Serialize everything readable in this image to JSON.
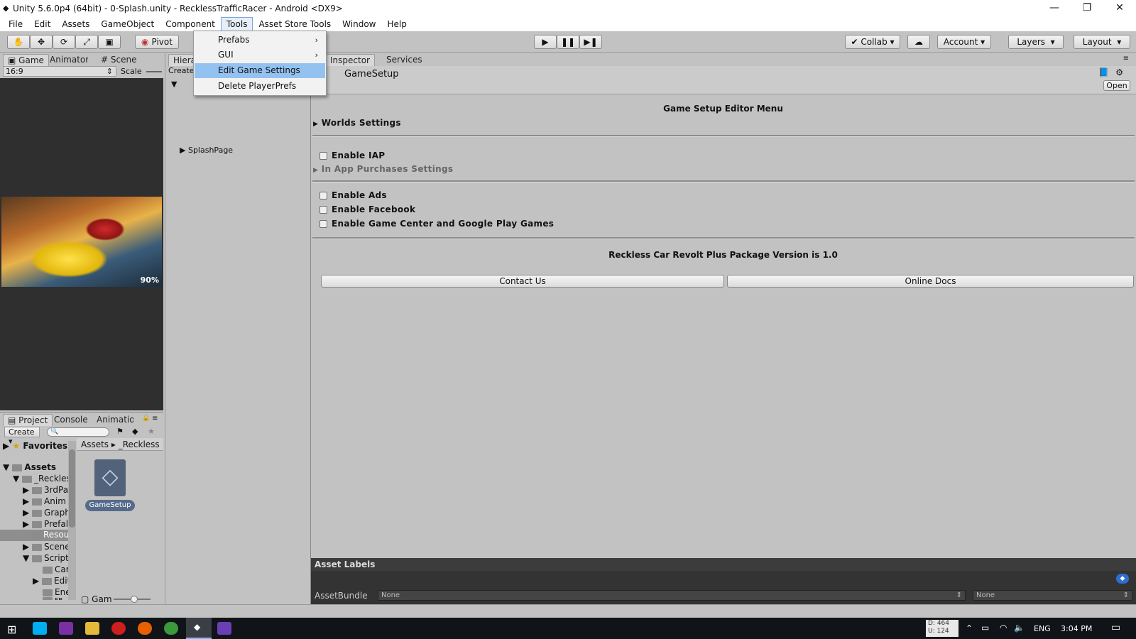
{
  "window": {
    "title": "Unity 5.6.0p4 (64bit) - 0-Splash.unity - RecklessTrafficRacer - Android <DX9>",
    "minimize": "—",
    "restore": "❐",
    "close": "✕"
  },
  "menu": [
    "File",
    "Edit",
    "Assets",
    "GameObject",
    "Component",
    "Tools",
    "Asset Store Tools",
    "Window",
    "Help"
  ],
  "tools_dropdown": {
    "items": [
      {
        "label": "Prefabs",
        "submenu": true
      },
      {
        "label": "GUI",
        "submenu": true
      },
      {
        "label": "Edit Game Settings",
        "highlighted": true
      },
      {
        "label": "Delete PlayerPrefs"
      }
    ]
  },
  "toolbar": {
    "pivot": "Pivot",
    "collab": "Collab",
    "account": "Account",
    "layers": "Layers",
    "layout": "Layout"
  },
  "game_panel": {
    "tabs": [
      "Game",
      "Animator",
      "Scene"
    ],
    "aspect": "16:9",
    "scale": "Scale",
    "zoom_badge": "90%"
  },
  "hierarchy": {
    "tab": "Hierarchy",
    "create": "Create",
    "item": "SplashPage"
  },
  "inspector": {
    "tabs": [
      "Inspector",
      "Services"
    ],
    "object_name": "GameSetup",
    "open_button": "Open",
    "header": "Game Setup Editor Menu",
    "worlds": "Worlds Settings",
    "enable_iap": "Enable IAP",
    "iap_settings": "In App Purchases Settings",
    "enable_ads": "Enable Ads",
    "enable_facebook": "Enable Facebook",
    "enable_gamecenter": "Enable Game Center and Google Play Games",
    "version": "Reckless Car Revolt Plus Package Version is 1.0",
    "contact": "Contact Us",
    "docs": "Online Docs",
    "asset_labels": "Asset Labels",
    "asset_bundle": "AssetBundle",
    "bundle_none_1": "None",
    "bundle_none_2": "None"
  },
  "project": {
    "tabs": [
      "Project",
      "Console",
      "Animation"
    ],
    "create": "Create",
    "favorites": "Favorites",
    "assets": "Assets",
    "path_root": "Assets",
    "path_sub": "_Reckless",
    "tree": [
      "_Reckles",
      "3rdPa",
      "Anim",
      "Graph",
      "Prefal",
      "Resou",
      "Scene",
      "Script",
      "Car",
      "Edit",
      "Ene",
      "FB"
    ],
    "file_name": "GameSetup",
    "slider_label": "Gam"
  },
  "taskbar": {
    "time": "3:04 PM",
    "lang": "ENG",
    "net_down": "D: 464",
    "net_up": "U: 124"
  },
  "colors": {
    "accent_highlight": "#94c2f0",
    "panel": "#c2c2c2",
    "dark_view": "#2f2f2f"
  }
}
